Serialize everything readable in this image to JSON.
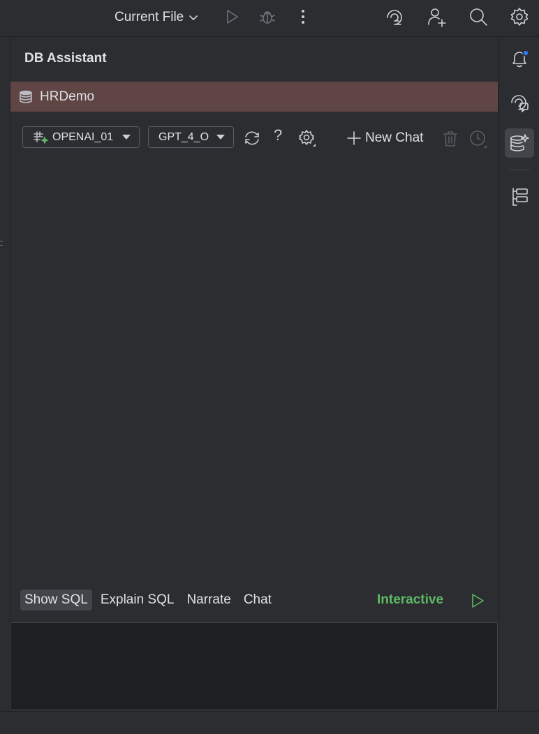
{
  "toolbar": {
    "run_config_label": "Current File",
    "icons": [
      "run-icon",
      "debug-icon",
      "more-vertical-icon",
      "ai-spiral-icon",
      "add-user-icon",
      "search-icon",
      "gear-icon"
    ]
  },
  "panel": {
    "title": "DB Assistant",
    "connection": {
      "name": "HRDemo",
      "icon": "database-icon"
    },
    "provider_combo": {
      "value": "OPENAI_01",
      "icon": "ai-provider-icon"
    },
    "model_combo": {
      "value": "GPT_4_O"
    },
    "actions": {
      "new_chat_label": "New Chat"
    },
    "modes": [
      {
        "label": "Show SQL",
        "active": true
      },
      {
        "label": "Explain SQL",
        "active": false
      },
      {
        "label": "Narrate",
        "active": false
      },
      {
        "label": "Chat",
        "active": false
      }
    ],
    "interactive_label": "Interactive",
    "input_value": ""
  },
  "right_stripe": {
    "items": [
      "notifications-icon",
      "ai-chat-icon",
      "db-assistant-icon",
      "structure-icon"
    ],
    "active": "db-assistant-icon"
  },
  "colors": {
    "background": "#2b2d30",
    "connection_row": "#5f4543",
    "interactive": "#5fb865",
    "notification_dot": "#3574f0",
    "input_area": "#1e1f22"
  }
}
